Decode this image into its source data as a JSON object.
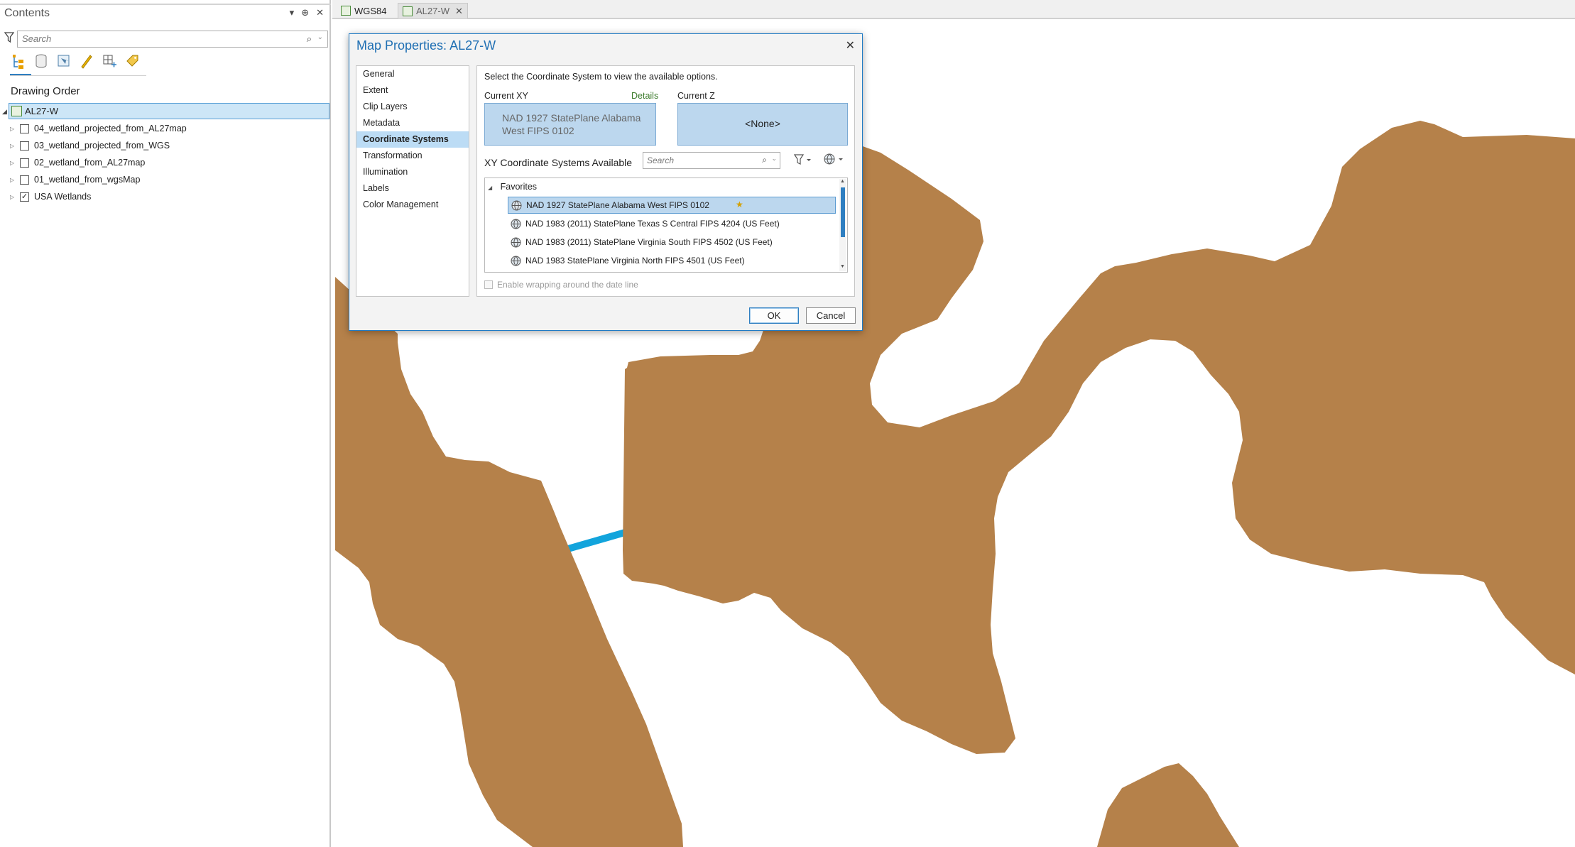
{
  "contents": {
    "title": "Contents",
    "controls": {
      "menu": "▾",
      "pin": "⊕",
      "close": "✕"
    },
    "search_placeholder": "Search",
    "search_icon": "⌕",
    "search_drop": "⌄",
    "section_label": "Drawing Order",
    "map_name": "AL27-W",
    "layers": [
      {
        "name": "04_wetland_projected_from_AL27map",
        "checked": false
      },
      {
        "name": "03_wetland_projected_from_WGS",
        "checked": false
      },
      {
        "name": "02_wetland_from_AL27map",
        "checked": false
      },
      {
        "name": "01_wetland_from_wgsMap",
        "checked": false
      },
      {
        "name": "USA Wetlands",
        "checked": true
      }
    ]
  },
  "tabs": [
    {
      "label": "WGS84",
      "active": false
    },
    {
      "label": "AL27-W",
      "active": true,
      "close": "✕"
    }
  ],
  "dialog": {
    "title": "Map Properties: AL27-W",
    "close": "✕",
    "nav": [
      "General",
      "Extent",
      "Clip Layers",
      "Metadata",
      "Coordinate Systems",
      "Transformation",
      "Illumination",
      "Labels",
      "Color Management"
    ],
    "nav_selected": "Coordinate Systems",
    "instruction": "Select the Coordinate System to view the available options.",
    "current_xy_label": "Current XY",
    "details_link": "Details",
    "current_z_label": "Current Z",
    "current_xy_line1": "NAD 1927 StatePlane Alabama",
    "current_xy_line2": "West FIPS 0102",
    "current_z_value": "<None>",
    "xy_available_label": "XY Coordinate Systems Available",
    "search_placeholder": "Search",
    "favorites_label": "Favorites",
    "coordinate_systems": [
      "NAD 1927 StatePlane Alabama West FIPS 0102",
      "NAD 1983 (2011) StatePlane Texas S Central FIPS 4204 (US Feet)",
      "NAD 1983 (2011) StatePlane Virginia South FIPS 4502 (US Feet)",
      "NAD 1983 StatePlane Virginia North FIPS 4501 (US Feet)"
    ],
    "wrap_option": "Enable wrapping around the date line",
    "ok_label": "OK",
    "cancel_label": "Cancel"
  },
  "colors": {
    "wetland_fill": "#b5814a",
    "line": "#12a4dc",
    "selection": "#bcd7ee",
    "accent": "#1f6fb3"
  }
}
